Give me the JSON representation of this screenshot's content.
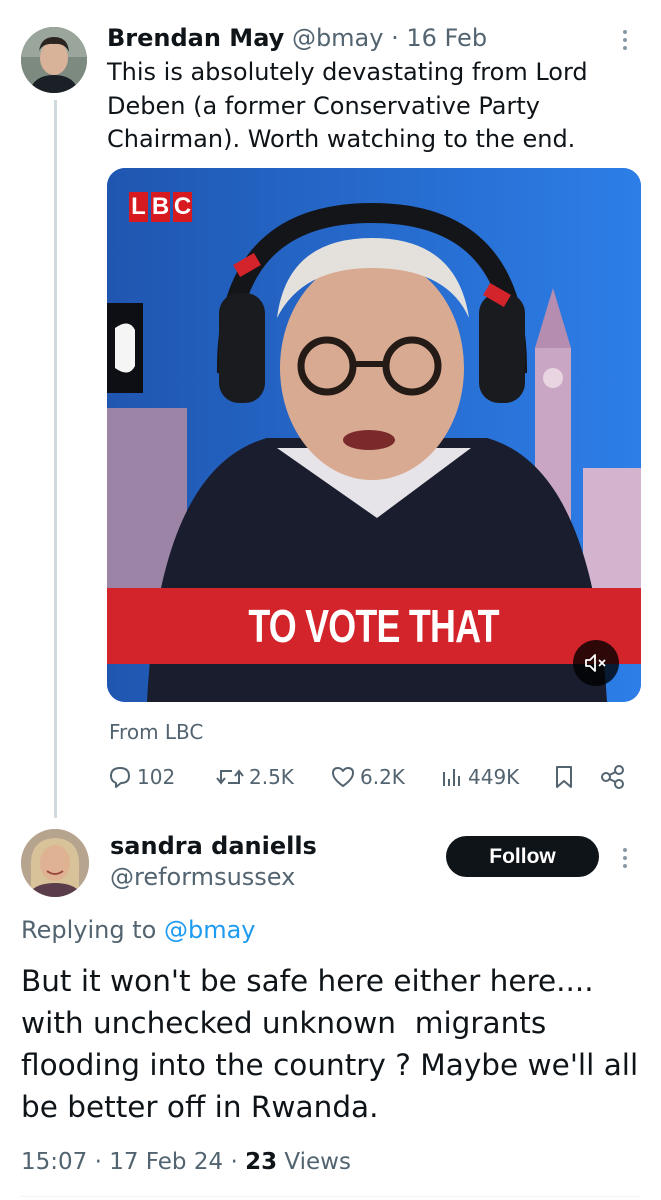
{
  "tweet": {
    "author_name": "Brendan May",
    "author_handle": "@bmay",
    "separator": "·",
    "date": "16 Feb",
    "text": "This is absolutely devastating from Lord Deben (a former Conservative Party Chairman). Worth watching to the end.",
    "media": {
      "logo_letters": [
        "L",
        "B",
        "C"
      ],
      "caption": "TO VOTE THAT",
      "background_colour": "#1f5fb8",
      "caption_colour": "#d3242b"
    },
    "from_label": "From LBC",
    "stats": {
      "replies": "102",
      "reposts": "2.5K",
      "likes": "6.2K",
      "views": "449K"
    }
  },
  "reply": {
    "author_name": "sandra daniells",
    "author_handle": "@reformsussex",
    "follow_label": "Follow",
    "replying_prefix": "Replying to",
    "replying_to": "@bmay",
    "text": "But it won't be safe here either here....  with unchecked unknown  migrants flooding into the country ? Maybe we'll all be better off in Rwanda.",
    "time": "15:07",
    "date": "17 Feb 24",
    "views_count": "23",
    "views_label": "Views"
  },
  "icons": [
    "more-icon",
    "reply-icon",
    "repost-icon",
    "like-icon",
    "views-icon",
    "bookmark-icon",
    "share-icon",
    "mute-icon"
  ],
  "colors": {
    "accent": "#1d9bf0",
    "muted": "#536471",
    "text": "#0f1419",
    "thread_line": "#cfd9de"
  }
}
